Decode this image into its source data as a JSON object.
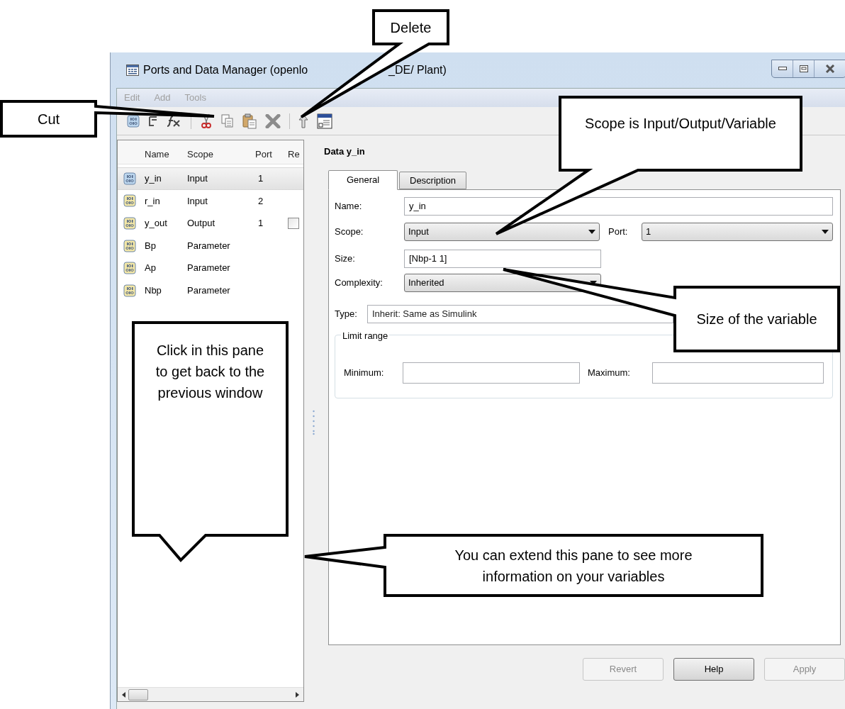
{
  "window": {
    "title_parts": [
      "Ports and Data Manager (openlo",
      "_DE/ Plant)"
    ]
  },
  "menu": [
    {
      "label": "Edit",
      "disabled": true
    },
    {
      "label": "Add",
      "disabled": true
    },
    {
      "label": "Tools",
      "disabled": true
    }
  ],
  "variables": {
    "columns": [
      "Name",
      "Scope",
      "Port",
      "Re"
    ],
    "rows": [
      {
        "name": "y_in",
        "scope": "Input",
        "port": "1",
        "selected": true
      },
      {
        "name": "r_in",
        "scope": "Input",
        "port": "2",
        "selected": false
      },
      {
        "name": "y_out",
        "scope": "Output",
        "port": "1",
        "selected": false,
        "checkbox": {
          "checked": false
        }
      },
      {
        "name": "Bp",
        "scope": "Parameter",
        "selected": false
      },
      {
        "name": "Ap",
        "scope": "Parameter",
        "selected": false
      },
      {
        "name": "Nbp",
        "scope": "Parameter",
        "selected": false
      }
    ]
  },
  "details": {
    "heading": "Data y_in",
    "tabs": [
      {
        "label": "General",
        "selected": true
      },
      {
        "label": "Description",
        "selected": false
      }
    ],
    "name": {
      "label": "Name:",
      "value": "y_in"
    },
    "scope": {
      "label": "Scope:",
      "value": "Input"
    },
    "port": {
      "label": "Port:",
      "value": "1"
    },
    "size": {
      "label": "Size:",
      "value": "[Nbp-1 1]"
    },
    "complexity": {
      "label": "Complexity:",
      "value": "Inherited"
    },
    "type": {
      "label": "Type:",
      "value": "Inherit: Same as Simulink"
    },
    "limit_range": {
      "title": "Limit range",
      "minimum_label": "Minimum:",
      "maximum_label": "Maximum:"
    }
  },
  "buttons": [
    {
      "label": "Revert",
      "disabled": true
    },
    {
      "label": "Help",
      "disabled": false
    },
    {
      "label": "Apply",
      "disabled": true
    }
  ],
  "callouts": [
    {
      "text": "Delete"
    },
    {
      "text": "Cut"
    },
    {
      "text": "Scope is Input/Output/Variable"
    },
    {
      "text": "Size of the variable"
    },
    {
      "text": "Click in this pane to get back to the previous window"
    },
    {
      "text": "You can extend this pane to see more information on your variables"
    }
  ]
}
